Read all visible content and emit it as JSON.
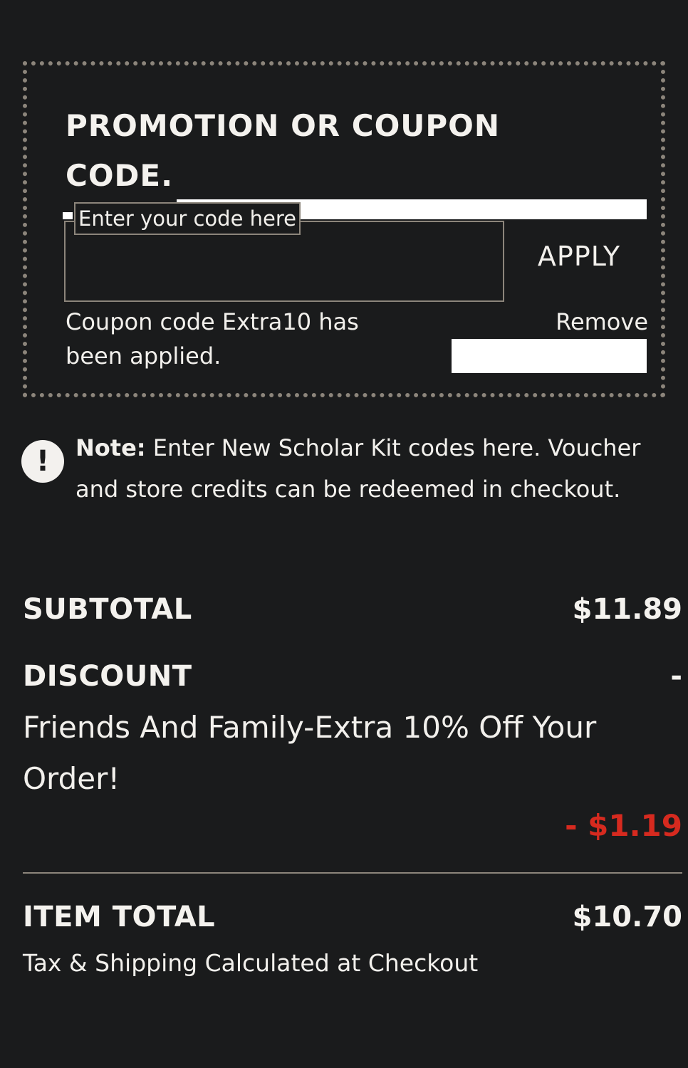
{
  "promo": {
    "title": "PROMOTION OR COUPON CODE.",
    "input_placeholder": "Enter your code here",
    "input_value": "",
    "apply_label": "APPLY",
    "applied_message": "Coupon code Extra10 has been applied.",
    "remove_label": "Remove"
  },
  "note": {
    "icon": "exclamation-circle-icon",
    "icon_glyph": "!",
    "label": "Note:",
    "text": " Enter New Scholar Kit codes here. Voucher and store credits can be redeemed in checkout."
  },
  "summary": {
    "subtotal_label": "SUBTOTAL",
    "subtotal_value": "$11.89",
    "discount_label": "DISCOUNT",
    "discount_value": "-",
    "discount_description": "Friends And Family-Extra 10% Off Your Order!",
    "discount_amount": "- $1.19",
    "item_total_label": "ITEM TOTAL",
    "item_total_value": "$10.70",
    "tax_note": "Tax & Shipping Calculated at Checkout"
  },
  "colors": {
    "background": "#1a1b1c",
    "text": "#f2f0ec",
    "border": "#8c857b",
    "discount_red": "#d62a1f"
  }
}
